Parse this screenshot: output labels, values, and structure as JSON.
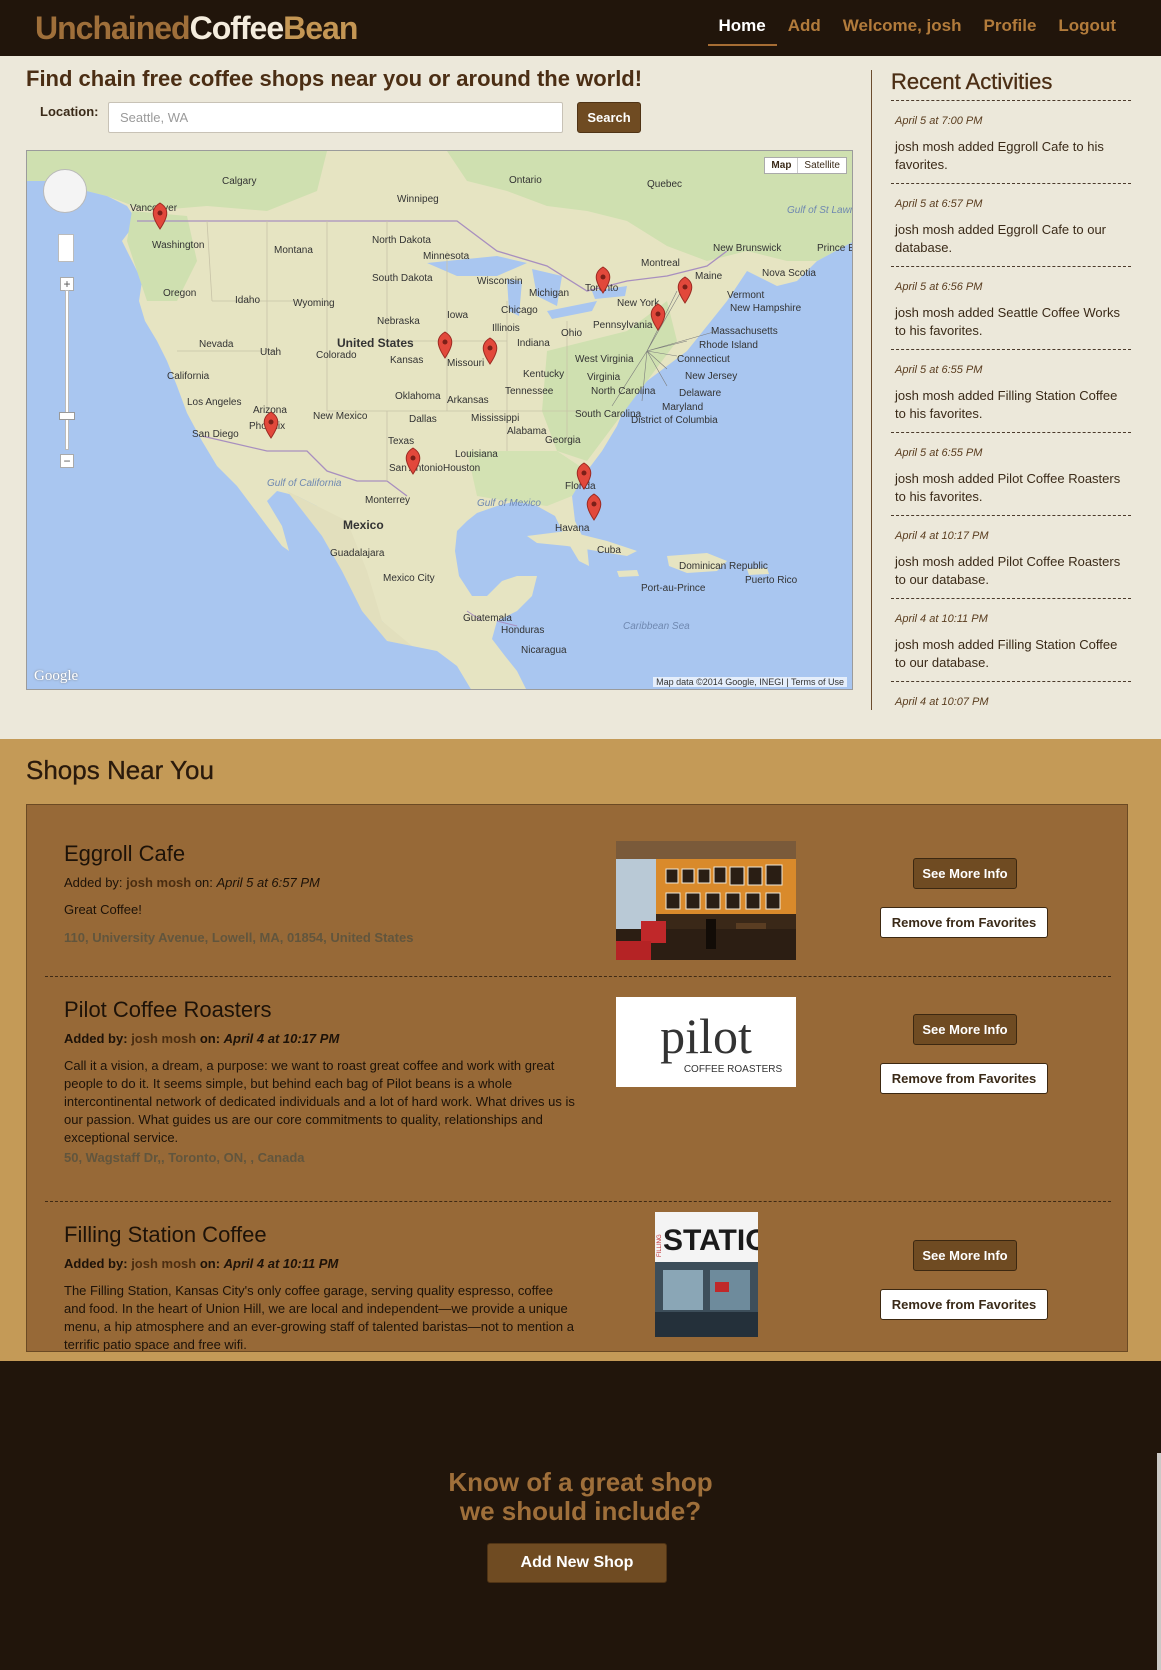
{
  "nav": {
    "brand_part1": "Unchained",
    "brand_part2": "Coffee",
    "brand_part3": "Bean",
    "items": [
      {
        "label": "Home",
        "active": true
      },
      {
        "label": "Add"
      },
      {
        "label": "Welcome, josh"
      },
      {
        "label": "Profile"
      },
      {
        "label": "Logout"
      }
    ]
  },
  "search": {
    "headline": "Find chain free coffee shops near you or around the world!",
    "location_label": "Location:",
    "placeholder": "Seattle, WA",
    "button_label": "Search"
  },
  "map": {
    "type_map": "Map",
    "type_satellite": "Satellite",
    "logo": "Google",
    "attribution": "Map data ©2014 Google, INEGI  |  Terms of Use",
    "zoom_in": "+",
    "zoom_out": "−",
    "labels": [
      "Calgary",
      "Ontario",
      "Quebec",
      "Winnipeg",
      "Vancouver",
      "Washington",
      "Montana",
      "North Dakota",
      "Minnesota",
      "South Dakota",
      "Wisconsin",
      "Michigan",
      "Toronto",
      "Montreal",
      "New Brunswick",
      "Prince Edward Island",
      "Nova Scotia",
      "Maine",
      "Vermont",
      "New Hampshire",
      "Massachusetts",
      "Rhode Island",
      "Connecticut",
      "New Jersey",
      "Delaware",
      "Maryland",
      "District of Columbia",
      "Oregon",
      "Idaho",
      "Wyoming",
      "Nebraska",
      "Iowa",
      "Chicago",
      "Illinois",
      "Indiana",
      "Ohio",
      "Pennsylvania",
      "New York",
      "Nevada",
      "Utah",
      "United States",
      "Colorado",
      "Kansas",
      "Missouri",
      "Kentucky",
      "West Virginia",
      "Virginia",
      "California",
      "Los Angeles",
      "Arizona",
      "Phoenix",
      "San Diego",
      "New Mexico",
      "Oklahoma",
      "Arkansas",
      "Tennessee",
      "North Carolina",
      "South Carolina",
      "Mississippi",
      "Alabama",
      "Georgia",
      "Dallas",
      "Texas",
      "Louisiana",
      "Houston",
      "San Antonio",
      "Florida",
      "Gulf of California",
      "Monterrey",
      "Mexico",
      "Guadalajara",
      "Mexico City",
      "Gulf of Mexico",
      "Havana",
      "Cuba",
      "Dominican Republic",
      "Puerto Rico",
      "Port-au-Prince",
      "Guatemala",
      "Honduras",
      "Nicaragua",
      "Caribbean Sea",
      "Gulf of St Lawrence"
    ]
  },
  "activities": {
    "title": "Recent Activities",
    "items": [
      {
        "when": "April 5 at 7:00 PM",
        "text": "josh mosh added Eggroll Cafe to his favorites."
      },
      {
        "when": "April 5 at 6:57 PM",
        "text": "josh mosh added Eggroll Cafe to our database."
      },
      {
        "when": "April 5 at 6:56 PM",
        "text": "josh mosh added Seattle Coffee Works to his favorites."
      },
      {
        "when": "April 5 at 6:55 PM",
        "text": "josh mosh added Filling Station Coffee to his favorites."
      },
      {
        "when": "April 5 at 6:55 PM",
        "text": "josh mosh added Pilot Coffee Roasters to his favorites."
      },
      {
        "when": "April 4 at 10:17 PM",
        "text": "josh mosh added Pilot Coffee Roasters to our database."
      },
      {
        "when": "April 4 at 10:11 PM",
        "text": "josh mosh added Filling Station Coffee to our database."
      },
      {
        "when": "April 4 at 10:07 PM",
        "text": ""
      }
    ]
  },
  "shops": {
    "title": "Shops Near You",
    "added_by_label": "Added by:",
    "on_label": "on:",
    "more_label": "See More Info",
    "remove_label": "Remove from Favorites",
    "items": [
      {
        "name": "Eggroll Cafe",
        "user": "josh mosh",
        "date": "April 5 at 6:57 PM",
        "description": "Great Coffee!",
        "address": "110, University Avenue, Lowell, MA, 01854, United States"
      },
      {
        "name": "Pilot Coffee Roasters",
        "user": "josh mosh",
        "date": "April 4 at 10:17 PM",
        "description": "Call it a vision, a dream, a purpose: we want to roast great coffee and work with great people to do it. It seems simple, but behind each bag of Pilot beans is a whole intercontinental network of dedicated individuals and a lot of hard work. What drives us is our passion. What guides us are our core commitments to quality, relationships and exceptional service.",
        "address": "50, Wagstaff Dr,, Toronto, ON, , Canada",
        "logo_word": "pilot",
        "logo_sub": "COFFEE ROASTERS"
      },
      {
        "name": "Filling Station Coffee",
        "user": "josh mosh",
        "date": "April 4 at 10:11 PM",
        "description": "The Filling Station, Kansas City's only coffee garage, serving quality espresso, coffee and food. In the heart of Union Hill, we are local and independent—we provide a unique menu, a hip atmosphere and an ever-growing staff of talented baristas—not to mention a terrific patio space and free wifi.",
        "address": "",
        "sign_word": "STATION",
        "sign_side": "FILLING"
      }
    ]
  },
  "footer": {
    "cta_line1": "Know of a great shop",
    "cta_line2": "we should include?",
    "button_label": "Add New Shop"
  },
  "colors": {
    "nav_bg": "#21150b",
    "accent": "#9f6f3a",
    "button": "#6f4b22",
    "page_bg": "#ece8da",
    "shops_bg": "#c49a57",
    "shop_card": "#976937",
    "marker": "#e2483b"
  }
}
